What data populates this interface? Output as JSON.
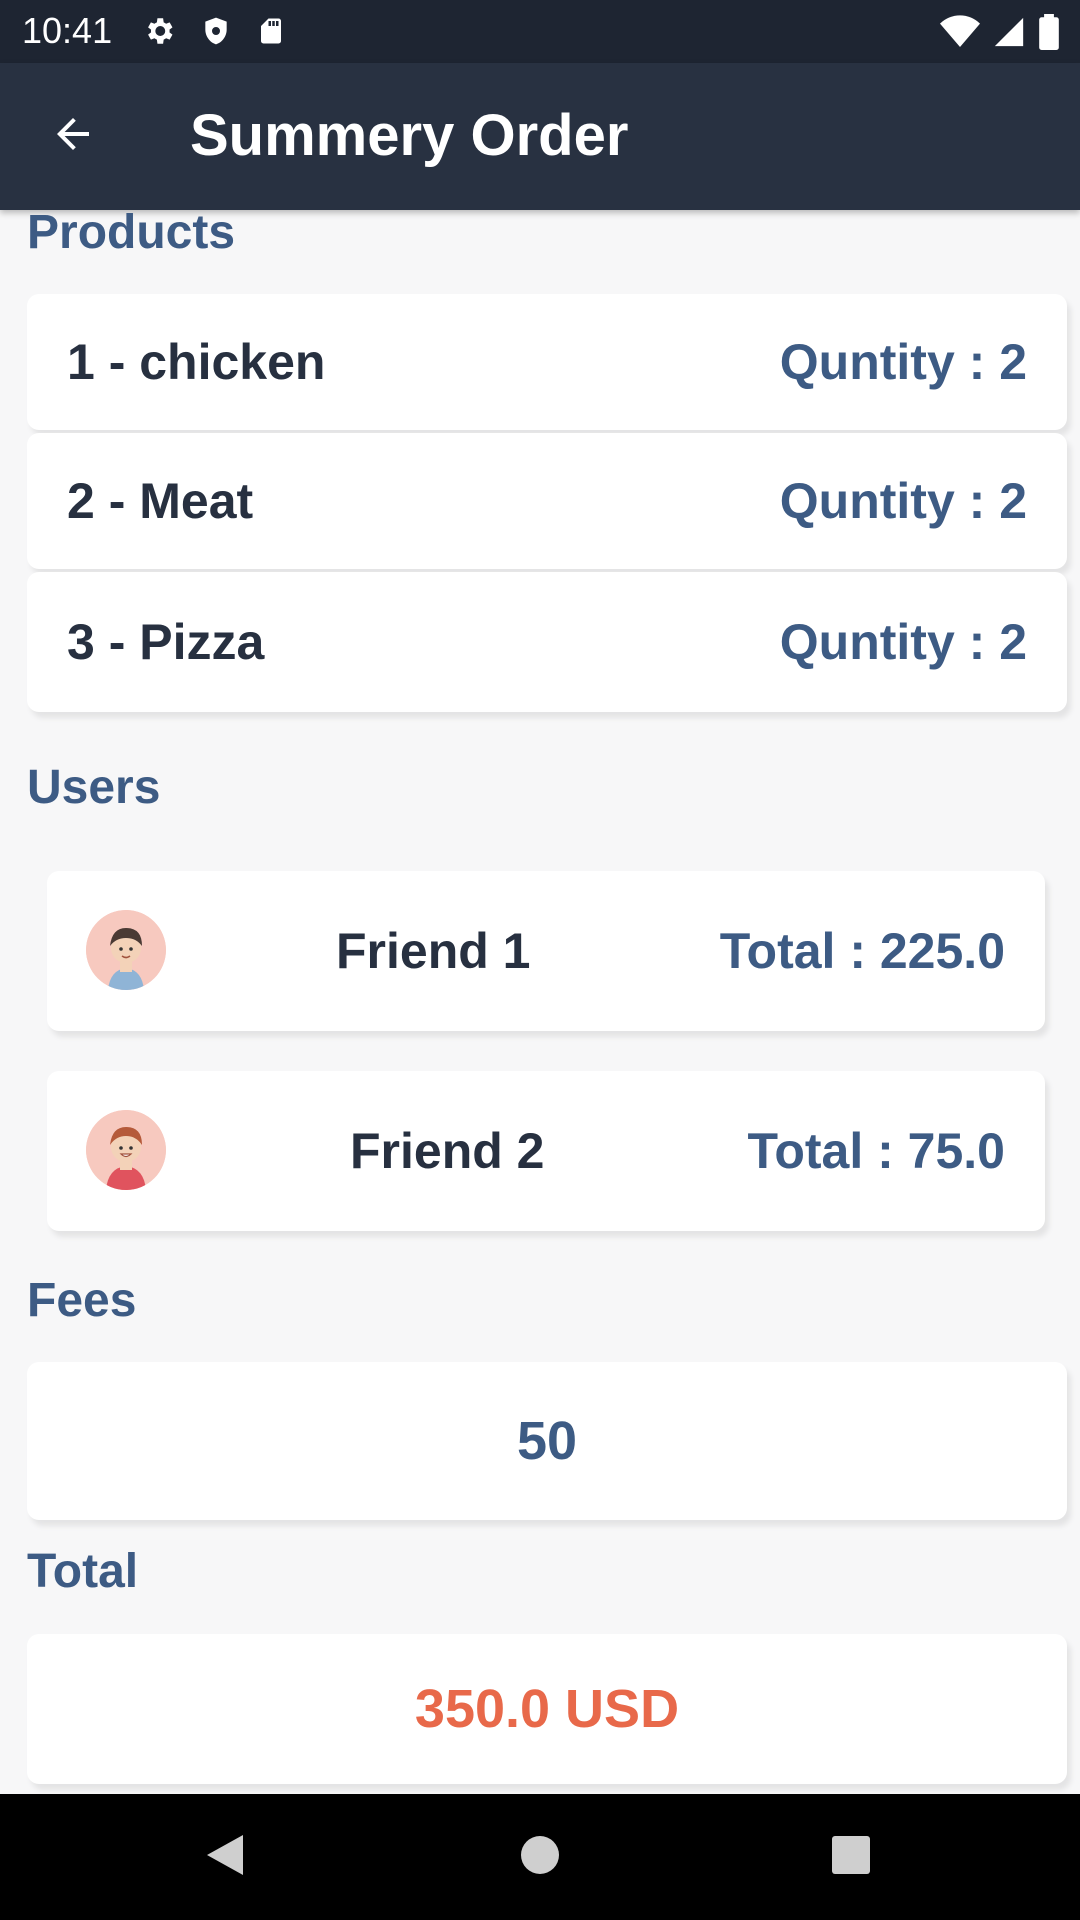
{
  "status_bar": {
    "time": "10:41",
    "icons_left": [
      "gear-icon",
      "shield-icon",
      "sd-card-icon"
    ],
    "icons_right": [
      "wifi-icon",
      "signal-icon",
      "battery-icon"
    ]
  },
  "app_bar": {
    "title": "Summery Order",
    "back_icon": "arrow-left-icon"
  },
  "sections": {
    "products_title": "Products",
    "users_title": "Users",
    "fees_title": "Fees",
    "total_title": "Total"
  },
  "products": [
    {
      "name": "1 - chicken",
      "quantity": "Quntity : 2"
    },
    {
      "name": "2 - Meat",
      "quantity": "Quntity : 2"
    },
    {
      "name": "3 - Pizza",
      "quantity": "Quntity : 2"
    }
  ],
  "users": [
    {
      "name": "Friend 1",
      "total": "Total : 225.0",
      "avatar": "boy-avatar-icon"
    },
    {
      "name": "Friend 2",
      "total": "Total : 75.0",
      "avatar": "boy-hoodie-avatar-icon"
    }
  ],
  "fees": {
    "value": "50"
  },
  "total": {
    "value": "350.0 USD"
  },
  "colors": {
    "app_bar": "#283141",
    "status_bar": "#1e2532",
    "accent_blue": "#3d5b84",
    "dark_text": "#273040",
    "total_orange": "#e8694a",
    "background": "#f7f7f8"
  },
  "nav_bar": {
    "icons": [
      "back-triangle-icon",
      "home-circle-icon",
      "recents-square-icon"
    ]
  }
}
